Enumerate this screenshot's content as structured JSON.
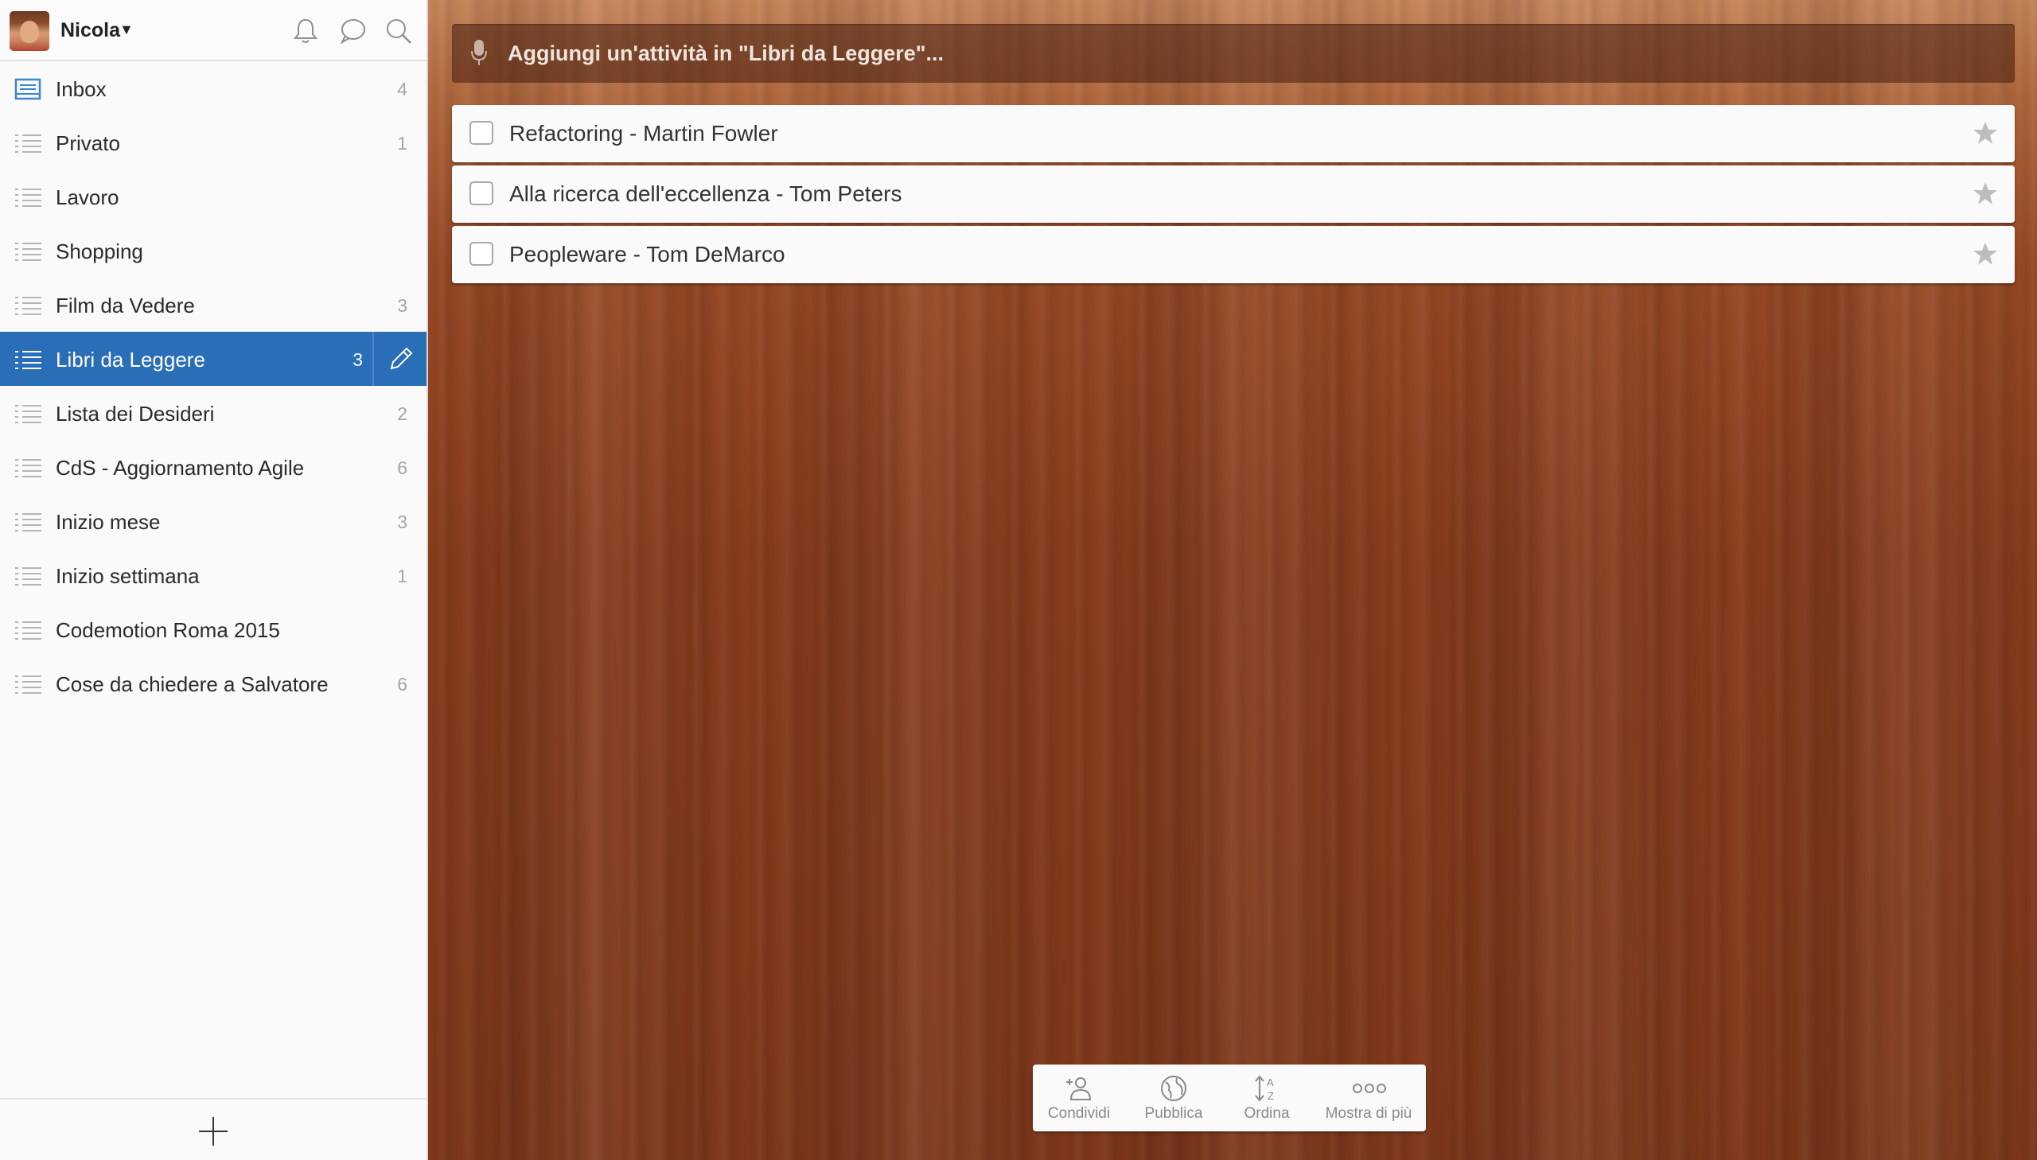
{
  "user": {
    "name": "Nicola"
  },
  "sidebar": {
    "items": [
      {
        "label": "Inbox",
        "count": "4",
        "icon": "inbox-icon"
      },
      {
        "label": "Privato",
        "count": "1",
        "icon": "list-icon"
      },
      {
        "label": "Lavoro",
        "count": "",
        "icon": "list-icon"
      },
      {
        "label": "Shopping",
        "count": "",
        "icon": "list-icon"
      },
      {
        "label": "Film da Vedere",
        "count": "3",
        "icon": "list-icon"
      },
      {
        "label": "Libri da Leggere",
        "count": "3",
        "icon": "list-icon",
        "active": true
      },
      {
        "label": "Lista dei Desideri",
        "count": "2",
        "icon": "list-icon"
      },
      {
        "label": "CdS - Aggiornamento Agile",
        "count": "6",
        "icon": "list-icon"
      },
      {
        "label": "Inizio mese",
        "count": "3",
        "icon": "list-icon"
      },
      {
        "label": "Inizio settimana",
        "count": "1",
        "icon": "list-icon"
      },
      {
        "label": "Codemotion Roma 2015",
        "count": "",
        "icon": "list-icon"
      },
      {
        "label": "Cose da chiedere a Salvatore",
        "count": "6",
        "icon": "list-icon"
      }
    ]
  },
  "main": {
    "add_placeholder": "Aggiungi un'attività in \"Libri da Leggere\"...",
    "tasks": [
      {
        "title": "Refactoring - Martin Fowler"
      },
      {
        "title": "Alla ricerca dell'eccellenza - Tom Peters"
      },
      {
        "title": "Peopleware - Tom DeMarco"
      }
    ]
  },
  "toolbar": {
    "share": "Condividi",
    "publish": "Pubblica",
    "sort": "Ordina",
    "more": "Mostra di più"
  },
  "colors": {
    "accent": "#2a6eb7",
    "sidebar_bg": "#fafafa",
    "wood": "#8a3d1d"
  }
}
